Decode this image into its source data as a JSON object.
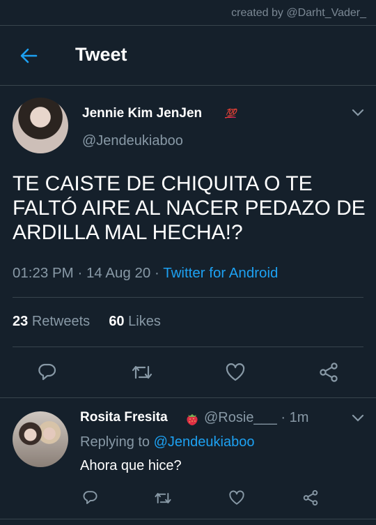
{
  "watermark": "created by @Darht_Vader_",
  "header": {
    "title": "Tweet",
    "back_icon": "arrow-left-icon"
  },
  "colors": {
    "background": "#15202b",
    "accent": "#1da1f2",
    "muted": "#8899a6",
    "divider": "#38444d"
  },
  "tweet": {
    "author_name": "Jennie Kim JenJen",
    "author_emoji": "💯",
    "author_handle": "@Jendeukiaboo",
    "text": "TE CAISTE DE CHIQUITA O TE FALTÓ AIRE AL NACER PEDAZO DE ARDILLA MAL HECHA!?",
    "time": "01:23 PM",
    "date": "14 Aug 20",
    "source": "Twitter for Android",
    "retweets_count": "23",
    "retweets_label": "Retweets",
    "likes_count": "60",
    "likes_label": "Likes"
  },
  "reply": {
    "author_name": "Rosita Fresita",
    "author_emoji": "🍓",
    "author_handle": "@Rosie___",
    "age": "1m",
    "replying_label": "Replying to",
    "replying_to": "@Jendeukiaboo",
    "text": "Ahora que hice?"
  }
}
